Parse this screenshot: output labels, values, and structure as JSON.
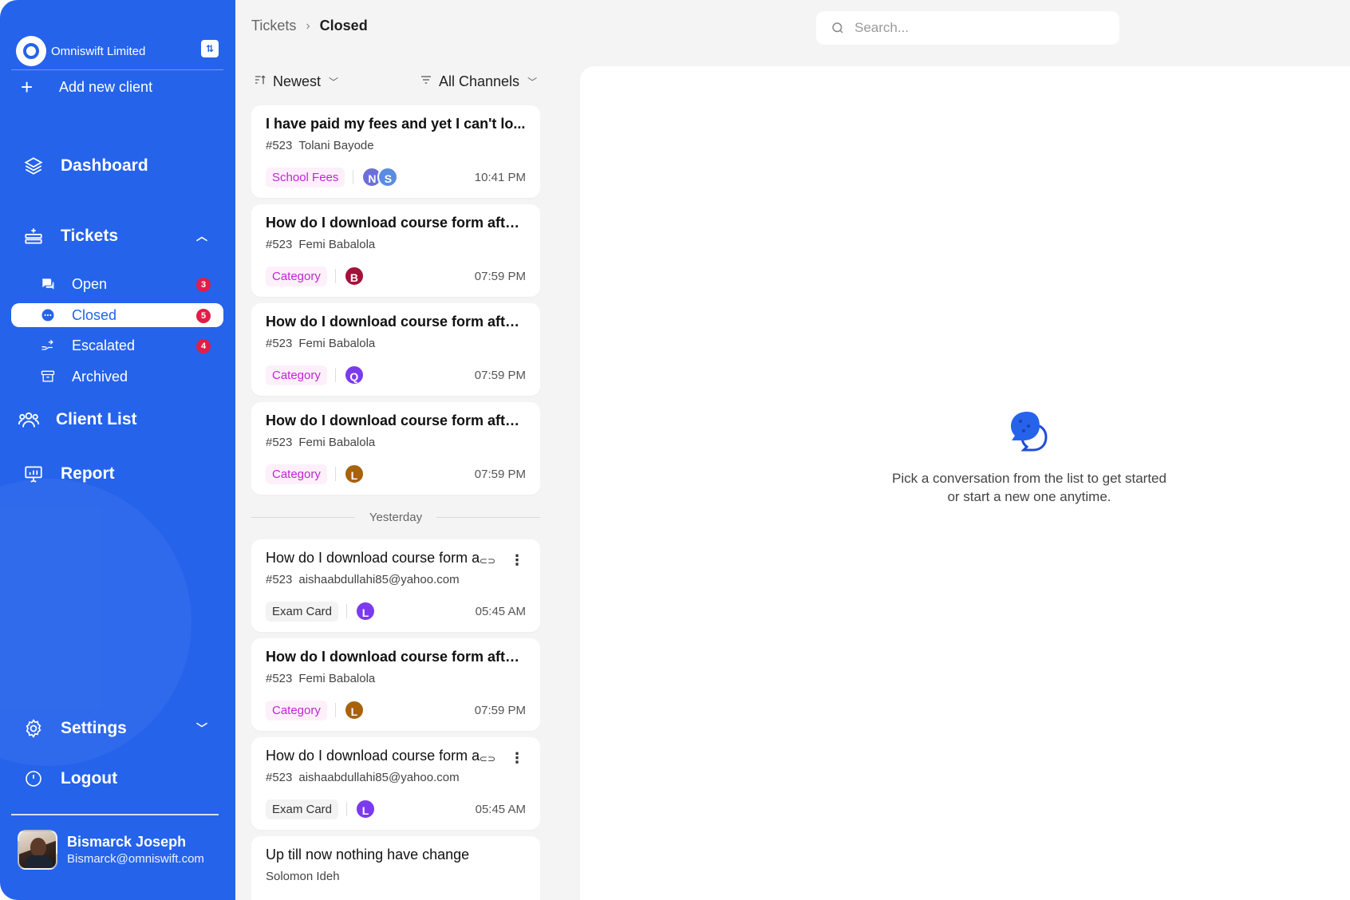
{
  "sidebar": {
    "client_name": "Omniswift Limited",
    "add_client_label": "Add new client",
    "nav": {
      "dashboard": "Dashboard",
      "tickets": "Tickets",
      "client_list": "Client List",
      "report": "Report",
      "settings": "Settings",
      "logout": "Logout"
    },
    "tickets_sub": [
      {
        "label": "Open",
        "count": "3",
        "icon": "chat-bubbles-icon"
      },
      {
        "label": "Closed",
        "count": "5",
        "icon": "chat-dots-icon"
      },
      {
        "label": "Escalated",
        "count": "4",
        "icon": "escalate-hand-icon"
      },
      {
        "label": "Archived",
        "count": "",
        "icon": "archive-box-icon"
      }
    ],
    "user": {
      "name": "Bismarck Joseph",
      "email": "Bismarck@omniswift.com"
    },
    "accent": "#2563eb"
  },
  "header": {
    "breadcrumb": [
      "Tickets",
      "Closed"
    ],
    "search_placeholder": "Search..."
  },
  "filters": {
    "sort": "Newest",
    "channel": "All Channels"
  },
  "tickets": [
    {
      "title": "I have paid my fees and yet I can't lo...",
      "number": "#523",
      "who": "Tolani Bayode",
      "tag": "School Fees",
      "tag_style": "pink",
      "avatars": [
        {
          "letter": "N",
          "color": "#6c6fd8"
        },
        {
          "letter": "S",
          "color": "#5a8de0"
        }
      ],
      "time": "10:41 PM"
    },
    {
      "title": "How do I download course form after...",
      "number": "#523",
      "who": "Femi Babalola",
      "tag": "Category",
      "tag_style": "pink",
      "avatars": [
        {
          "letter": "B",
          "color": "#a3123a"
        }
      ],
      "time": "07:59 PM"
    },
    {
      "title": "How do I download course form after...",
      "number": "#523",
      "who": "Femi Babalola",
      "tag": "Category",
      "tag_style": "pink",
      "avatars": [
        {
          "letter": "Q",
          "color": "#7c3aed"
        }
      ],
      "time": "07:59 PM"
    },
    {
      "title": "How do I download course form after...",
      "number": "#523",
      "who": "Femi Babalola",
      "tag": "Category",
      "tag_style": "pink",
      "avatars": [
        {
          "letter": "L",
          "color": "#a8620c"
        }
      ],
      "time": "07:59 PM"
    }
  ],
  "day_divider": "Yesterday",
  "tickets_yesterday": [
    {
      "title": "How do I download course form a",
      "number": "#523",
      "who": "aishaabdullahi85@yahoo.com",
      "tag": "Exam Card",
      "tag_style": "grey",
      "avatars": [
        {
          "letter": "L",
          "color": "#7c3aed"
        }
      ],
      "time": "05:45 AM",
      "tools": true
    },
    {
      "title": "How do I download course form after...",
      "number": "#523",
      "who": "Femi Babalola",
      "tag": "Category",
      "tag_style": "pink",
      "avatars": [
        {
          "letter": "L",
          "color": "#a8620c"
        }
      ],
      "time": "07:59 PM",
      "tools": false
    },
    {
      "title": "How do I download course form a",
      "number": "#523",
      "who": "aishaabdullahi85@yahoo.com",
      "tag": "Exam Card",
      "tag_style": "grey",
      "avatars": [
        {
          "letter": "L",
          "color": "#7c3aed"
        }
      ],
      "time": "05:45 AM",
      "tools": true
    }
  ],
  "ticket_partial": {
    "title": "Up till now nothing have change",
    "who": "Solomon Ideh"
  },
  "empty_state": {
    "message": "Pick a conversation from the list to get started or start a new one anytime."
  }
}
